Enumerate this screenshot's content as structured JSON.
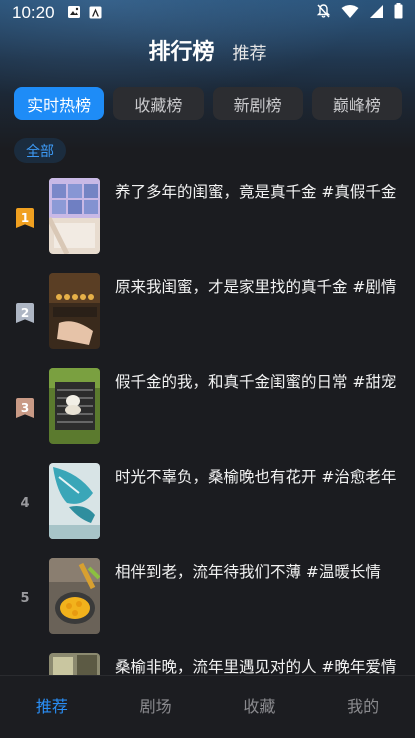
{
  "status": {
    "time": "10:20",
    "left_icons": [
      "gallery-icon",
      "app-a-icon"
    ],
    "right_icons": [
      "mute-bell-icon",
      "wifi-icon",
      "signal-icon",
      "battery-icon"
    ]
  },
  "header": {
    "title": "排行榜",
    "subtitle": "推荐"
  },
  "tabs": [
    {
      "label": "实时热榜",
      "active": true
    },
    {
      "label": "收藏榜",
      "active": false
    },
    {
      "label": "新剧榜",
      "active": false
    },
    {
      "label": "巅峰榜",
      "active": false
    }
  ],
  "filter_chip": "全部",
  "list": [
    {
      "rank": "1",
      "title": "养了多年的闺蜜，竟是真千金 #真假千金"
    },
    {
      "rank": "2",
      "title": "原来我闺蜜，才是家里找的真千金 #剧情"
    },
    {
      "rank": "3",
      "title": "假千金的我，和真千金闺蜜的日常 #甜宠"
    },
    {
      "rank": "4",
      "title": "时光不辜负，桑榆晚也有花开 #治愈老年"
    },
    {
      "rank": "5",
      "title": "相伴到老，流年待我们不薄 #温暖长情"
    },
    {
      "rank": "",
      "title": "桑榆非晚，流年里遇见对的人 #晚年爱情"
    }
  ],
  "rank_colors": {
    "1": "#f0a020",
    "2": "#aeb6c4",
    "3": "#c99a86"
  },
  "bottom_nav": [
    {
      "label": "推荐",
      "active": true
    },
    {
      "label": "剧场",
      "active": false
    },
    {
      "label": "收藏",
      "active": false
    },
    {
      "label": "我的",
      "active": false
    }
  ],
  "accent": "#1e8cf7"
}
